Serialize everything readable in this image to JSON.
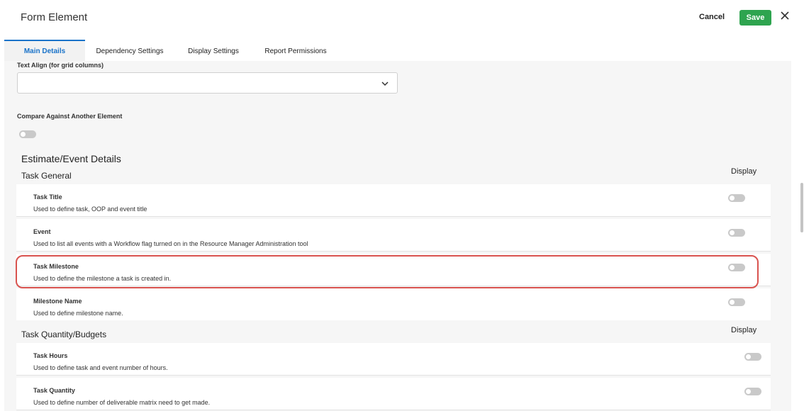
{
  "header": {
    "title": "Form Element",
    "cancel_label": "Cancel",
    "save_label": "Save",
    "save_color": "#2ea44f"
  },
  "tabs": [
    {
      "label": "Main Details",
      "active": true
    },
    {
      "label": "Dependency Settings",
      "active": false
    },
    {
      "label": "Display Settings",
      "active": false
    },
    {
      "label": "Report Permissions",
      "active": false
    }
  ],
  "text_align": {
    "label": "Text Align (for grid columns)",
    "value": ""
  },
  "compare": {
    "label": "Compare Against Another Element",
    "enabled": false
  },
  "estimate_section": {
    "title": "Estimate/Event Details",
    "groups": [
      {
        "title": "Task General",
        "display_label": "Display",
        "rows": [
          {
            "name": "Task Title",
            "description": "Used to define task, OOP and event title",
            "enabled": false
          },
          {
            "name": "Event",
            "description": "Used to list all events with a Workflow flag turned on in the Resource Manager Administration tool",
            "enabled": false
          },
          {
            "name": "Task Milestone",
            "description": "Used to define the milestone a task is created in.",
            "enabled": false,
            "highlighted": true
          },
          {
            "name": "Milestone Name",
            "description": "Used to define milestone name.",
            "enabled": false
          }
        ]
      },
      {
        "title": "Task Quantity/Budgets",
        "display_label": "Display",
        "rows": [
          {
            "name": "Task Hours",
            "description": "Used to define task and event number of hours.",
            "enabled": false
          },
          {
            "name": "Task Quantity",
            "description": "Used to define number of deliverable matrix need to get made.",
            "enabled": false
          }
        ]
      }
    ]
  },
  "colors": {
    "accent": "#1a73c9",
    "highlight_border": "#d9534f"
  }
}
